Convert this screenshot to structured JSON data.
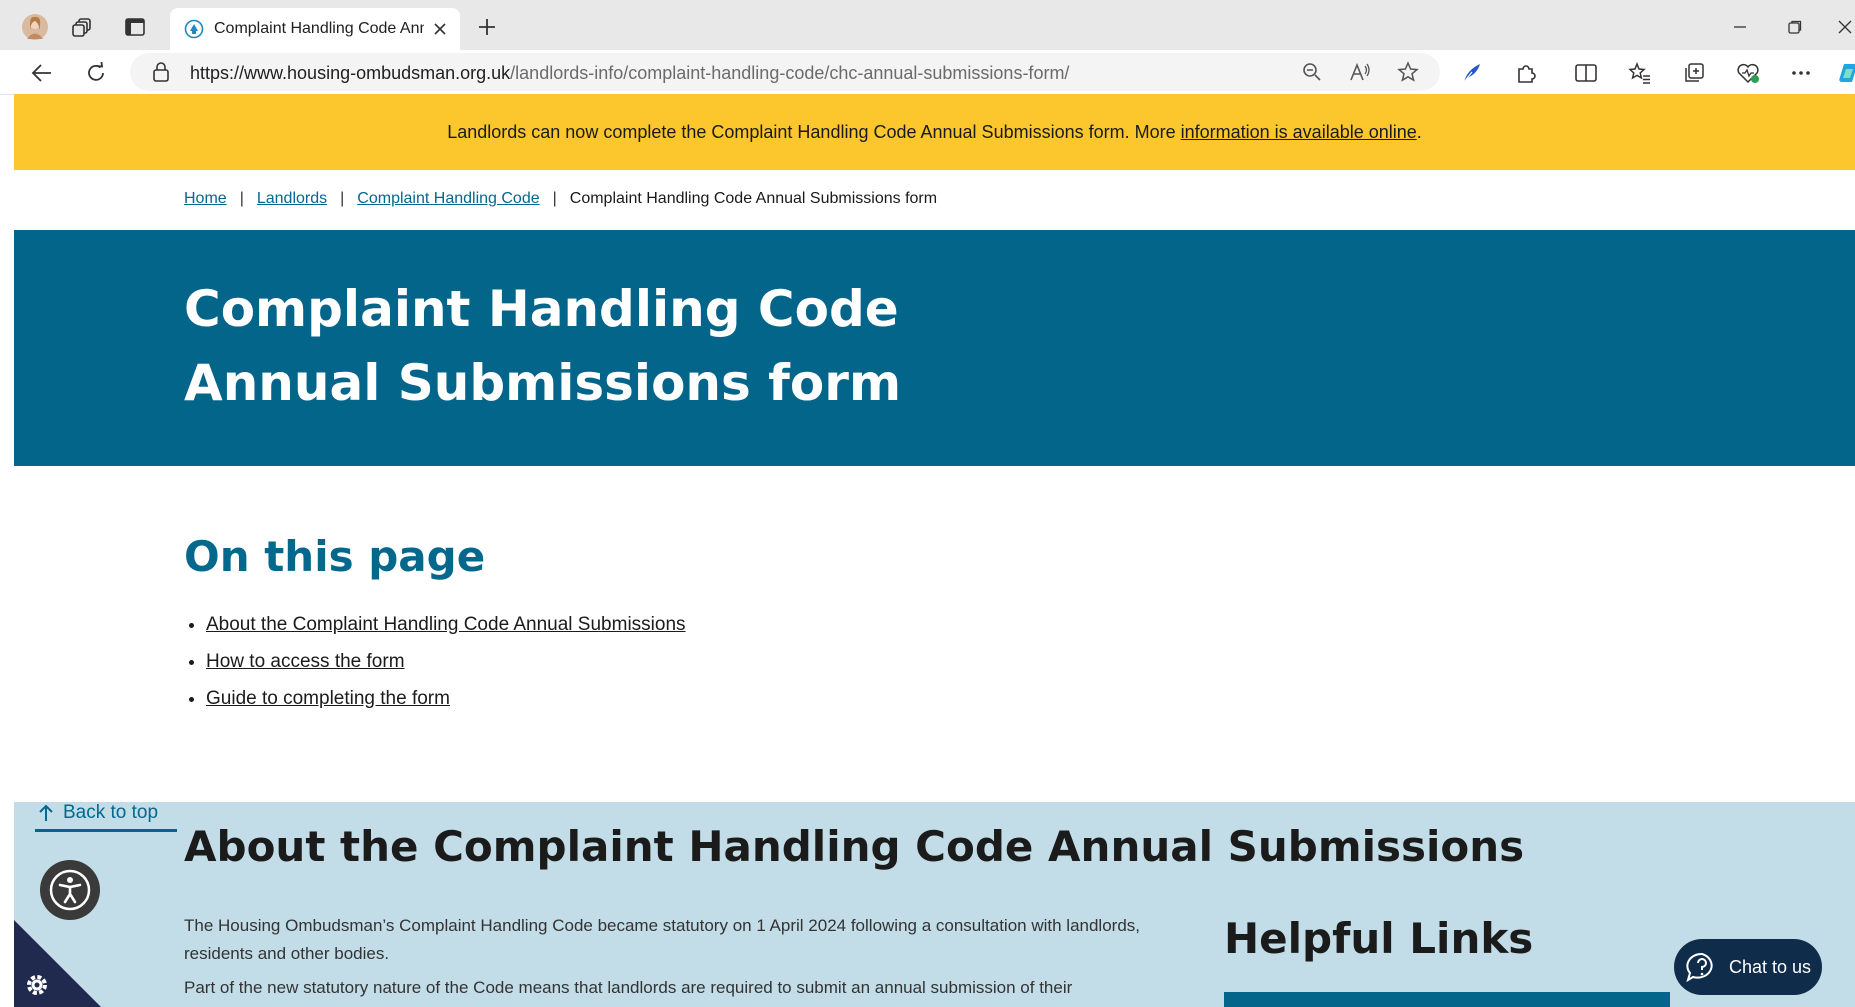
{
  "browser": {
    "tab_title": "Complaint Handling Code Annual Submissions form",
    "address": {
      "host": "https://www.housing-ombudsman.org.uk",
      "path": "/landlords-info/complaint-handling-code/chc-annual-submissions-form/"
    },
    "icons": {
      "strip": [
        "profile-avatar",
        "workspaces-icon",
        "vertical-tabs-icon"
      ],
      "toolbar_right": [
        "zoom-out-icon",
        "read-aloud-icon",
        "favorite-star-icon",
        "copilot-feather-icon",
        "extensions-icon",
        "split-screen-icon",
        "favorites-icon",
        "collections-icon",
        "browser-essentials-icon",
        "more-icon",
        "copilot-icon"
      ],
      "window_controls": [
        "minimize-icon",
        "restore-icon",
        "close-icon"
      ]
    }
  },
  "announcement": {
    "text": "Landlords can now complete the Complaint Handling Code Annual Submissions form. More ",
    "link": "information is available online",
    "suffix": "."
  },
  "breadcrumb": {
    "items": [
      "Home",
      "Landlords",
      "Complaint Handling Code"
    ],
    "current": "Complaint Handling Code Annual Submissions form",
    "separator": "|"
  },
  "hero": {
    "title": "Complaint Handling Code Annual Submissions form"
  },
  "on_this_page": {
    "heading": "On this page",
    "links": [
      "About the Complaint Handling Code Annual Submissions",
      "How to access the form",
      "Guide to completing the form"
    ]
  },
  "back_to_top": "Back to top",
  "about": {
    "heading": "About the Complaint Handling Code Annual Submissions",
    "p1": "The Housing Ombudsman’s Complaint Handling Code became statutory on 1 April 2024 following a consultation with landlords, residents and other bodies.",
    "p2": "Part of the new statutory nature of the Code means that landlords are required to submit an annual submission of their"
  },
  "helpful_links": {
    "heading": "Helpful Links"
  },
  "chat": {
    "label": "Chat to us"
  },
  "colors": {
    "banner": "#fcc62d",
    "hero": "#04658b",
    "link_teal": "#04688d",
    "section_bg": "#c2dde8",
    "chat_bg": "#0f2c4a"
  }
}
